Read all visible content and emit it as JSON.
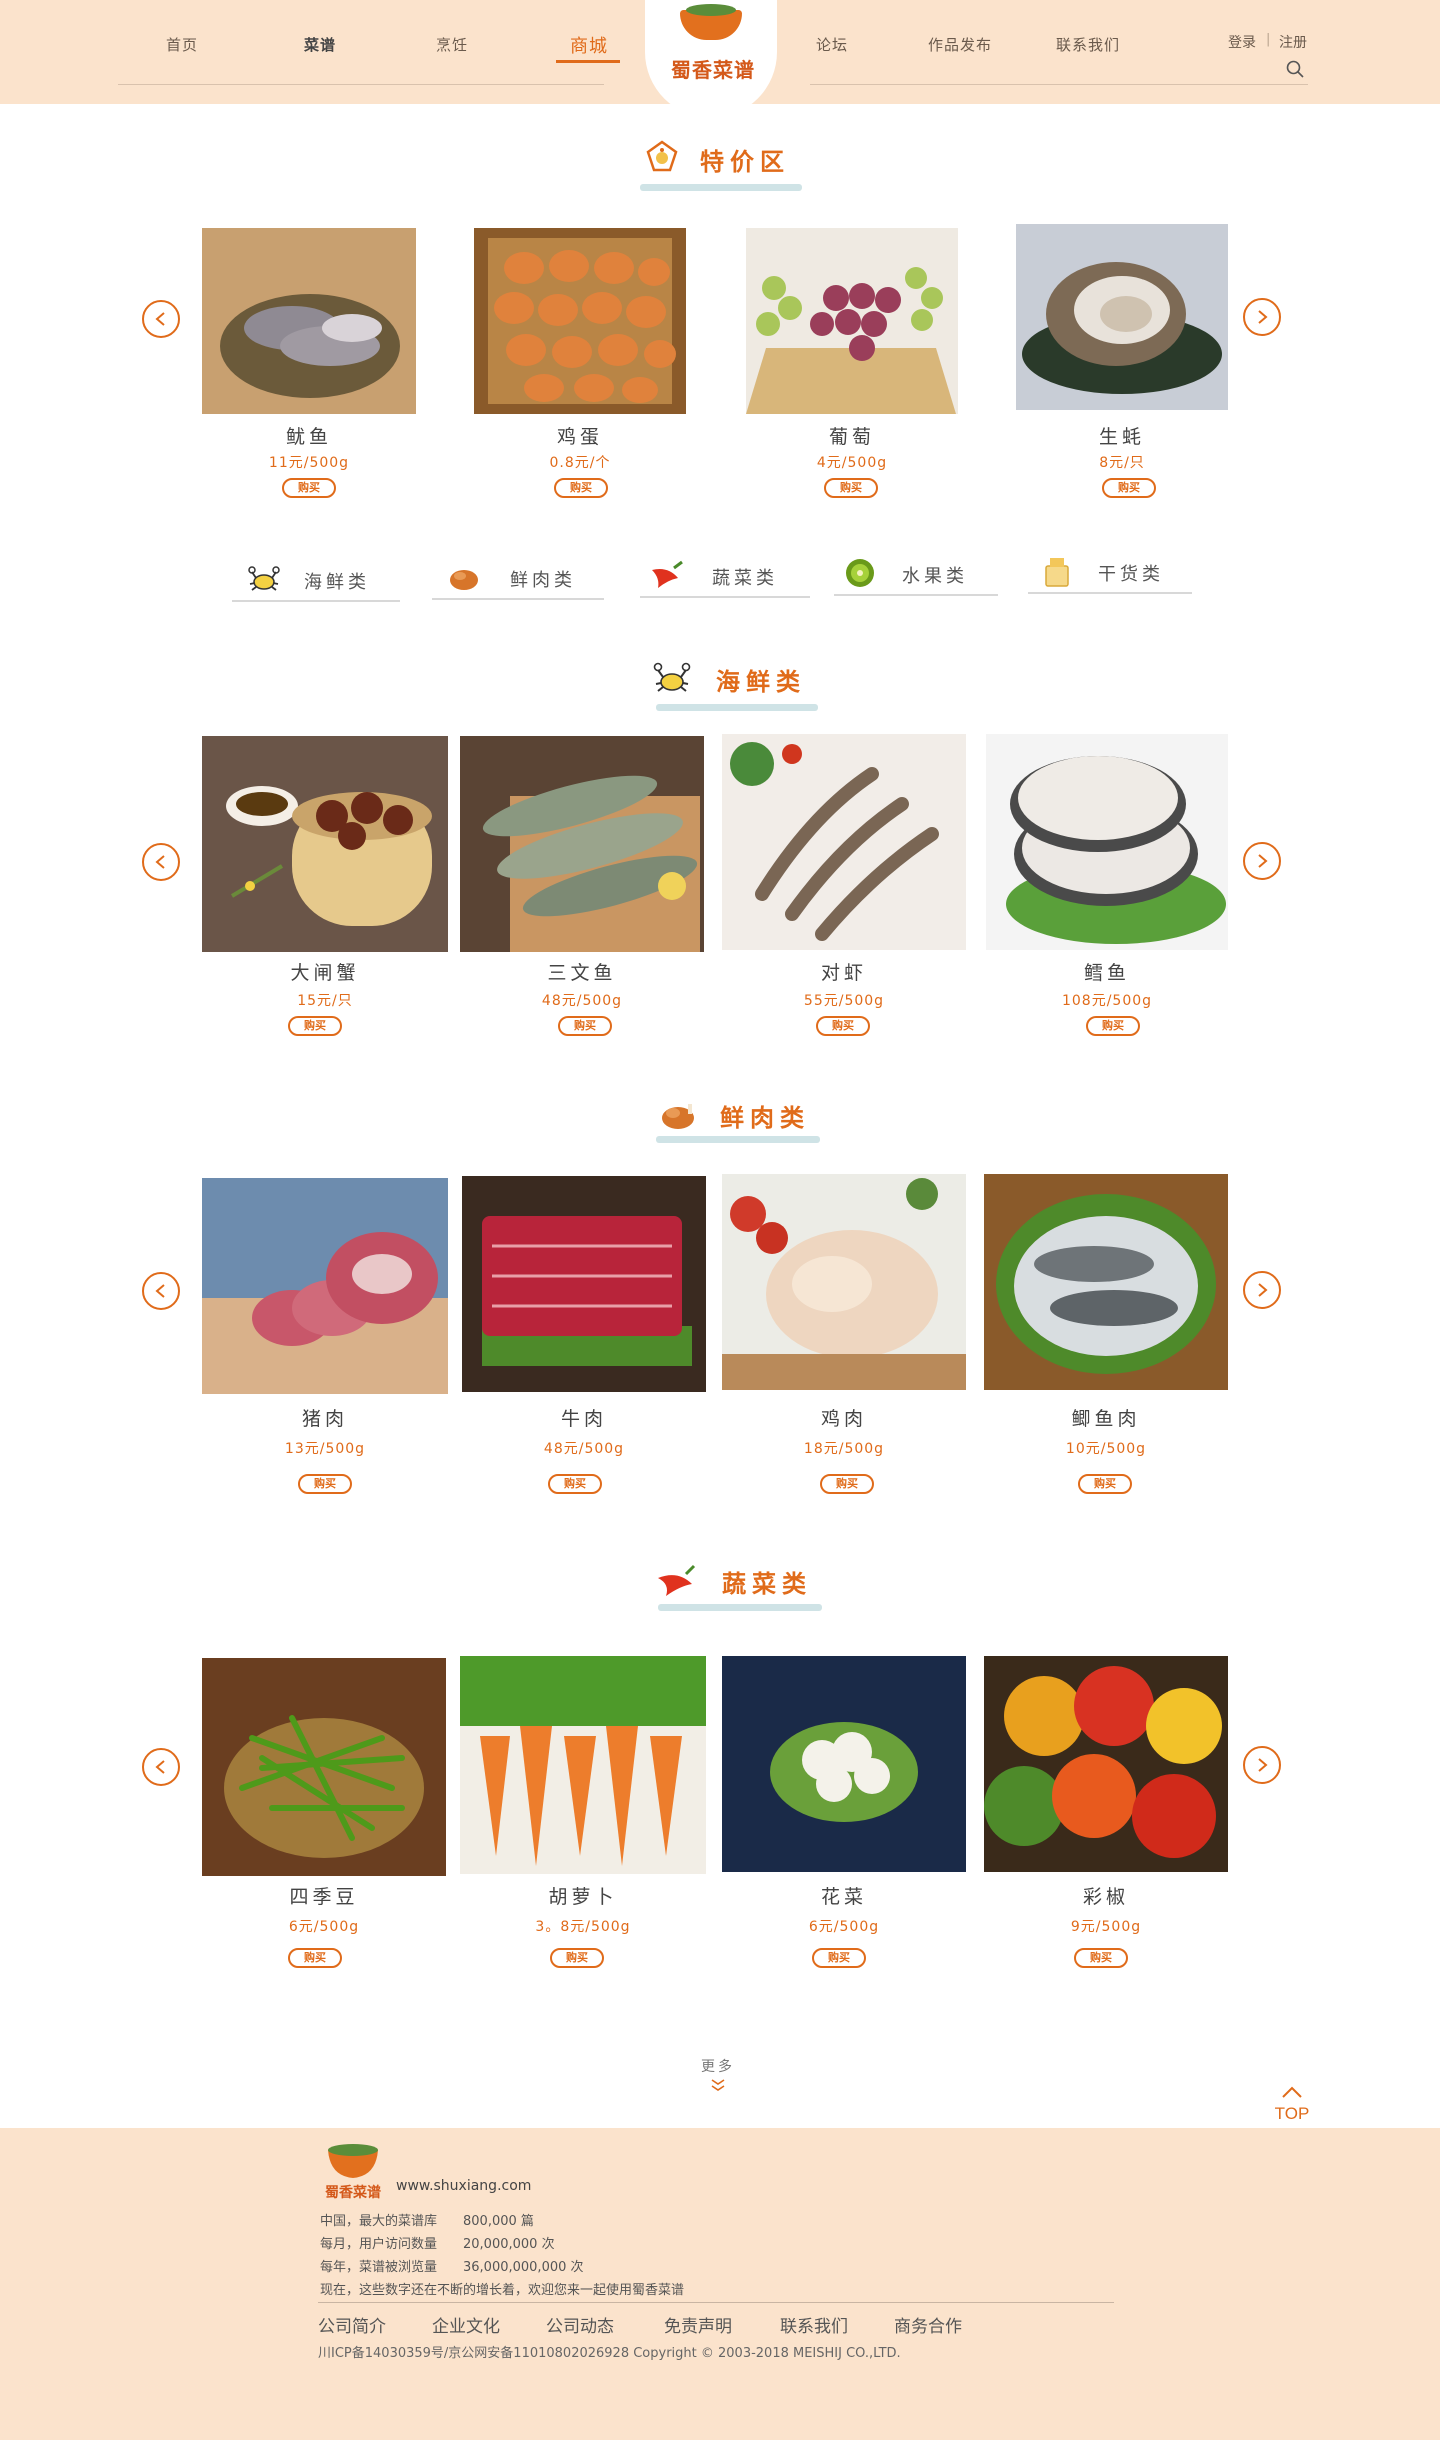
{
  "header": {
    "nav_left": [
      "首页",
      "菜谱",
      "烹饪",
      "商城"
    ],
    "nav_right": [
      "论坛",
      "作品发布",
      "联系我们"
    ],
    "logo_text": "蜀香菜谱",
    "login": "登录",
    "separator": "|",
    "register": "注册",
    "active_tab": "商城"
  },
  "sections": {
    "special": {
      "title": "特价区",
      "items": [
        {
          "name": "鱿鱼",
          "price": "11元/500g",
          "buy": "购买"
        },
        {
          "name": "鸡蛋",
          "price": "0.8元/个",
          "buy": "购买"
        },
        {
          "name": "葡萄",
          "price": "4元/500g",
          "buy": "购买"
        },
        {
          "name": "生蚝",
          "price": "8元/只",
          "buy": "购买"
        }
      ]
    },
    "categories": [
      "海鲜类",
      "鲜肉类",
      "蔬菜类",
      "水果类",
      "干货类"
    ],
    "seafood": {
      "title": "海鲜类",
      "items": [
        {
          "name": "大闸蟹",
          "price": "15元/只",
          "buy": "购买"
        },
        {
          "name": "三文鱼",
          "price": "48元/500g",
          "buy": "购买"
        },
        {
          "name": "对虾",
          "price": "55元/500g",
          "buy": "购买"
        },
        {
          "name": "鳕鱼",
          "price": "108元/500g",
          "buy": "购买"
        }
      ]
    },
    "meat": {
      "title": "鲜肉类",
      "items": [
        {
          "name": "猪肉",
          "price": "13元/500g",
          "buy": "购买"
        },
        {
          "name": "牛肉",
          "price": "48元/500g",
          "buy": "购买"
        },
        {
          "name": "鸡肉",
          "price": "18元/500g",
          "buy": "购买"
        },
        {
          "name": "鲫鱼肉",
          "price": "10元/500g",
          "buy": "购买"
        }
      ]
    },
    "vegetable": {
      "title": "蔬菜类",
      "items": [
        {
          "name": "四季豆",
          "price": "6元/500g",
          "buy": "购买"
        },
        {
          "name": "胡萝卜",
          "price": "3。8元/500g",
          "buy": "购买"
        },
        {
          "name": "花菜",
          "price": "6元/500g",
          "buy": "购买"
        },
        {
          "name": "彩椒",
          "price": "9元/500g",
          "buy": "购买"
        }
      ]
    }
  },
  "more": "更多",
  "top": "TOP",
  "footer": {
    "logo_text": "蜀香菜谱",
    "url": "www.shuxiang.com",
    "stats": [
      "中国，最大的菜谱库　　800,000 篇",
      "每月，用户访问数量　　20,000,000 次",
      "每年，菜谱被浏览量　　36,000,000,000 次",
      "现在，这些数字还在不断的增长着，欢迎您来一起使用蜀香菜谱"
    ],
    "links": [
      "公司简介",
      "企业文化",
      "公司动态",
      "免责声明",
      "联系我们",
      "商务合作"
    ],
    "copyright": "川ICP备14030359号/京公网安备11010802026928 Copyright © 2003-2018 MEISHIJ CO.,LTD."
  },
  "colors": {
    "accent": "#e06b1a",
    "header_bg": "#fbe3cc",
    "title_bar": "#cfe3e6"
  }
}
